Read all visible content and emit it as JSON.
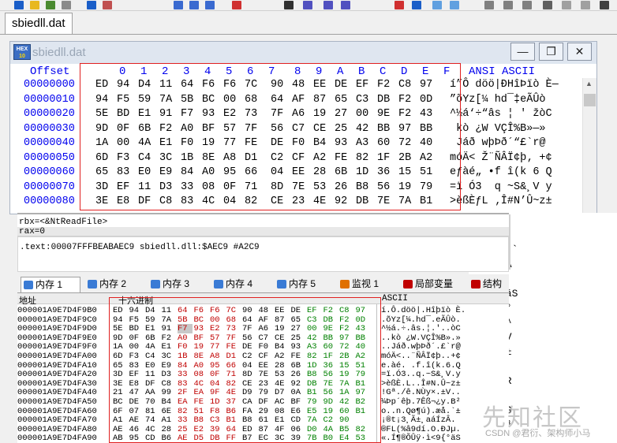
{
  "tab": {
    "filename": "sbiedll.dat"
  },
  "hexwin": {
    "title": "sbiedll.dat",
    "logo_line1": "HEX",
    "logo_line2": "10",
    "header": {
      "offset": "Offset",
      "columns": [
        "0",
        "1",
        "2",
        "3",
        "4",
        "5",
        "6",
        "7",
        "8",
        "9",
        "A",
        "B",
        "C",
        "D",
        "E",
        "F"
      ],
      "ansi": "ANSI ASCII"
    },
    "rows": [
      {
        "offset": "00000000",
        "bytes": [
          "ED",
          "94",
          "D4",
          "11",
          "64",
          "F6",
          "F6",
          "7C",
          "90",
          "48",
          "EE",
          "DE",
          "EF",
          "F2",
          "C8",
          "97"
        ],
        "ascii": "í”Ô döö|ĐHîÞïò È—"
      },
      {
        "offset": "00000010",
        "bytes": [
          "94",
          "F5",
          "59",
          "7A",
          "5B",
          "BC",
          "00",
          "68",
          "64",
          "AF",
          "87",
          "65",
          "C3",
          "DB",
          "F2",
          "0D"
        ],
        "ascii": "”õYz[¼ hd¯‡eÃÛò"
      },
      {
        "offset": "00000020",
        "bytes": [
          "5E",
          "BD",
          "E1",
          "91",
          "F7",
          "93",
          "E2",
          "73",
          "7F",
          "A6",
          "19",
          "27",
          "00",
          "9E",
          "F2",
          "43"
        ],
        "ascii": "^½á‘÷“âs ¦ ' žòC"
      },
      {
        "offset": "00000030",
        "bytes": [
          "9D",
          "0F",
          "6B",
          "F2",
          "A0",
          "BF",
          "57",
          "7F",
          "56",
          "C7",
          "CE",
          "25",
          "42",
          "BB",
          "97",
          "BB"
        ],
        "ascii": " kò ¿W VÇÎ%B»—»"
      },
      {
        "offset": "00000040",
        "bytes": [
          "1A",
          "00",
          "4A",
          "E1",
          "F0",
          "19",
          "77",
          "FE",
          "DE",
          "F0",
          "B4",
          "93",
          "A3",
          "60",
          "72",
          "40"
        ],
        "ascii": " Jáð wþÞð´“£`r@"
      },
      {
        "offset": "00000050",
        "bytes": [
          "6D",
          "F3",
          "C4",
          "3C",
          "1B",
          "8E",
          "A8",
          "D1",
          "C2",
          "CF",
          "A2",
          "FE",
          "82",
          "1F",
          "2B",
          "A2"
        ],
        "ascii": "móÄ< Ž¨ÑÂÏ¢þ‚ +¢"
      },
      {
        "offset": "00000060",
        "bytes": [
          "65",
          "83",
          "E0",
          "E9",
          "84",
          "A0",
          "95",
          "66",
          "04",
          "EE",
          "28",
          "6B",
          "1D",
          "36",
          "15",
          "51"
        ],
        "ascii": "eƒàé„ •f î(k 6 Q"
      },
      {
        "offset": "00000070",
        "bytes": [
          "3D",
          "EF",
          "11",
          "D3",
          "33",
          "08",
          "0F",
          "71",
          "8D",
          "7E",
          "53",
          "26",
          "B8",
          "56",
          "19",
          "79"
        ],
        "ascii": "=ï Ó3  q ~S&¸V y"
      },
      {
        "offset": "00000080",
        "bytes": [
          "3E",
          "E8",
          "DF",
          "C8",
          "83",
          "4C",
          "04",
          "82",
          "CE",
          "23",
          "4E",
          "92",
          "DB",
          "7E",
          "7A",
          "B1"
        ],
        "ascii": ">èßÈƒL ‚Î#N’Û~z±"
      }
    ]
  },
  "registers": {
    "line1": "rbx=<&NtReadFile>",
    "line2": "rax=0"
  },
  "disasm": {
    "text": ".text:00007FFFBEABAEC9 sbiedll.dll:$AEC9 #A2C9"
  },
  "dump_tabs": [
    {
      "label": "内存 1",
      "icon": "memory-icon",
      "color": "#3a7bd5",
      "active": true
    },
    {
      "label": "内存 2",
      "icon": "memory-icon",
      "color": "#3a7bd5",
      "active": false
    },
    {
      "label": "内存 3",
      "icon": "memory-icon",
      "color": "#3a7bd5",
      "active": false
    },
    {
      "label": "内存 4",
      "icon": "memory-icon",
      "color": "#3a7bd5",
      "active": false
    },
    {
      "label": "内存 5",
      "icon": "memory-icon",
      "color": "#3a7bd5",
      "active": false
    },
    {
      "label": "监视 1",
      "icon": "watch-icon",
      "color": "#e07000",
      "active": false
    },
    {
      "label": "局部变量",
      "icon": "locals-icon",
      "color": "#c00000",
      "active": false
    },
    {
      "label": "结构",
      "icon": "struct-icon",
      "color": "#c00000",
      "active": false
    }
  ],
  "dump": {
    "col_address": "地址",
    "col_hex": "十六进制",
    "col_ascii": "ASCII",
    "rows": [
      {
        "addr": "000001A9E7D4F9B0",
        "hex": [
          "ED",
          "94",
          "D4",
          "11",
          "64",
          "F6",
          "F6",
          "7C",
          "90",
          "48",
          "EE",
          "DE",
          "EF",
          "F2",
          "C8",
          "97"
        ],
        "ascii": "í.Ô.döö|.Hîþïò È."
      },
      {
        "addr": "000001A9E7D4F9C0",
        "hex": [
          "94",
          "F5",
          "59",
          "7A",
          "5B",
          "BC",
          "00",
          "68",
          "64",
          "AF",
          "87",
          "65",
          "C3",
          "DB",
          "F2",
          "0D"
        ],
        "ascii": ".õYz[¼.hd¯.eÃÛò."
      },
      {
        "addr": "000001A9E7D4F9D0",
        "hex": [
          "5E",
          "BD",
          "E1",
          "91",
          "F7",
          "93",
          "E2",
          "73",
          "7F",
          "A6",
          "19",
          "27",
          "00",
          "9E",
          "F2",
          "43"
        ],
        "ascii": "^½á.÷.âs.¦.'..òC"
      },
      {
        "addr": "000001A9E7D4F9E0",
        "hex": [
          "9D",
          "0F",
          "6B",
          "F2",
          "A0",
          "BF",
          "57",
          "7F",
          "56",
          "C7",
          "CE",
          "25",
          "42",
          "BB",
          "97",
          "BB"
        ],
        "ascii": "..kò ¿W.VÇÎ%B».»"
      },
      {
        "addr": "000001A9E7D4F9F0",
        "hex": [
          "1A",
          "00",
          "4A",
          "E1",
          "F0",
          "19",
          "77",
          "FE",
          "DE",
          "F0",
          "B4",
          "93",
          "A3",
          "60",
          "72",
          "40"
        ],
        "ascii": "..Jáð.wþÞð´.£`r@"
      },
      {
        "addr": "000001A9E7D4FA00",
        "hex": [
          "6D",
          "F3",
          "C4",
          "3C",
          "1B",
          "8E",
          "A8",
          "D1",
          "C2",
          "CF",
          "A2",
          "FE",
          "82",
          "1F",
          "2B",
          "A2"
        ],
        "ascii": "móÄ<..¨ÑÂÏ¢þ..+¢"
      },
      {
        "addr": "000001A9E7D4FA10",
        "hex": [
          "65",
          "83",
          "E0",
          "E9",
          "84",
          "A0",
          "95",
          "66",
          "04",
          "EE",
          "28",
          "6B",
          "1D",
          "36",
          "15",
          "51"
        ],
        "ascii": "e.àé. .f.î(k.6.Q"
      },
      {
        "addr": "000001A9E7D4FA20",
        "hex": [
          "3D",
          "EF",
          "11",
          "D3",
          "33",
          "08",
          "0F",
          "71",
          "8D",
          "7E",
          "53",
          "26",
          "B8",
          "56",
          "19",
          "79"
        ],
        "ascii": "=ï.Ó3..q.~S&¸V.y"
      },
      {
        "addr": "000001A9E7D4FA30",
        "hex": [
          "3E",
          "E8",
          "DF",
          "C8",
          "83",
          "4C",
          "04",
          "82",
          "CE",
          "23",
          "4E",
          "92",
          "DB",
          "7E",
          "7A",
          "B1"
        ],
        "ascii": ">èßÈ.L..Î#N.Û~z±"
      },
      {
        "addr": "000001A9E7D4FA40",
        "hex": [
          "21",
          "47",
          "AA",
          "99",
          "2F",
          "EA",
          "9F",
          "4E",
          "D9",
          "79",
          "D7",
          "0A",
          "B1",
          "56",
          "1A",
          "97"
        ],
        "ascii": "!Gª./ê.NÙy×.±V.."
      },
      {
        "addr": "000001A9E7D4FA50",
        "hex": [
          "BC",
          "DE",
          "70",
          "B4",
          "EA",
          "FE",
          "1D",
          "37",
          "CA",
          "DF",
          "AC",
          "BF",
          "79",
          "9D",
          "42",
          "B2"
        ],
        "ascii": "¼Þp´êþ.7Êß¬¿y.B²"
      },
      {
        "addr": "000001A9E7D4FA60",
        "hex": [
          "6F",
          "07",
          "81",
          "6E",
          "82",
          "51",
          "F8",
          "B6",
          "FA",
          "29",
          "08",
          "E6",
          "E5",
          "19",
          "60",
          "B1"
        ],
        "ascii": "o..n.Qø¶ú).æå.`±"
      },
      {
        "addr": "000001A9E7D4FA70",
        "hex": [
          "A1",
          "AE",
          "74",
          "A1",
          "33",
          "B8",
          "C3",
          "B1",
          "B8",
          "61",
          "E1",
          "CD",
          "7A",
          "C2",
          "90"
        ],
        "ascii": "¡®t¡3¸Ã±¸aáÍzÂ."
      },
      {
        "addr": "000001A9E7D4FA80",
        "hex": [
          "AE",
          "46",
          "4C",
          "28",
          "25",
          "E2",
          "39",
          "64",
          "ED",
          "87",
          "4F",
          "06",
          "D0",
          "4A",
          "B5",
          "82"
        ],
        "ascii": "®FL(%â9dí.O.ÐJµ."
      },
      {
        "addr": "000001A9E7D4FA90",
        "hex": [
          "AB",
          "95",
          "CD",
          "B6",
          "AE",
          "D5",
          "DB",
          "FF",
          "B7",
          "EC",
          "3C",
          "39",
          "7B",
          "B0",
          "E4",
          "53"
        ],
        "ascii": "«.Í¶®ÕÛÿ·ì<9{°äS"
      }
    ]
  },
  "right_ascii": [
    "y× ±V ¹",
    "Þ- ¿ B²",
    "ø¶) æå `",
    "«.aáÍzÂ",
    "O ÐJµ‚",
    "·ì<9{°äS",
    "ä¿C¢' °",
    "¤©O|µ ^",
    "ÍÕÔ[e V",
    "#N.Û~z±",
    "h,ÎimB",
    "Ï,¢'ë'R",
    "¤«O/ì×",
    "Y'' pQG",
    "Í  ¹ÿ ³",
    "ÍÔ£»"
  ],
  "watermark": {
    "big": "先知社区",
    "small": "CSDN @君衍、架构师小马"
  }
}
